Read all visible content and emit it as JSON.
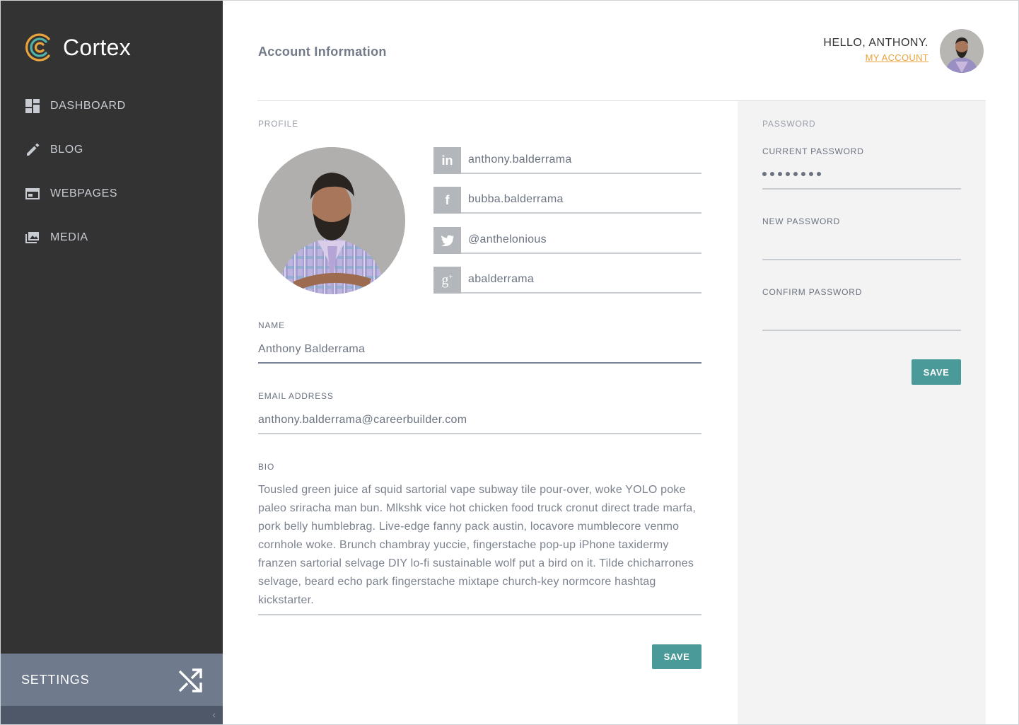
{
  "app": {
    "name": "Cortex"
  },
  "sidebar": {
    "items": [
      {
        "label": "DASHBOARD",
        "icon": "dashboard-icon"
      },
      {
        "label": "BLOG",
        "icon": "pencil-icon"
      },
      {
        "label": "WEBPAGES",
        "icon": "webpage-icon"
      },
      {
        "label": "MEDIA",
        "icon": "media-icon"
      }
    ],
    "settings": {
      "label": "SETTINGS",
      "icon": "shuffle-icon"
    },
    "collapse_icon": "chevron-left-icon"
  },
  "header": {
    "title": "Account Information",
    "greeting": "HELLO, ANTHONY.",
    "account_link": "MY ACCOUNT"
  },
  "profile": {
    "section_label": "PROFILE",
    "social": [
      {
        "network": "linkedin",
        "icon": "linkedin-icon",
        "value": "anthony.balderrama"
      },
      {
        "network": "facebook",
        "icon": "facebook-icon",
        "value": "bubba.balderrama"
      },
      {
        "network": "twitter",
        "icon": "twitter-icon",
        "value": "@anthelonious"
      },
      {
        "network": "google-plus",
        "icon": "google-plus-icon",
        "value": "abalderrama"
      }
    ],
    "name_label": "NAME",
    "name_value": "Anthony Balderrama",
    "email_label": "EMAIL ADDRESS",
    "email_value": "anthony.balderrama@careerbuilder.com",
    "bio_label": "BIO",
    "bio_value": "Tousled green juice af squid sartorial vape subway tile pour-over, woke YOLO poke paleo sriracha man bun. Mlkshk vice hot chicken food truck cronut direct trade marfa, pork belly humblebrag. Live-edge fanny pack austin, locavore mumblecore venmo cornhole woke. Brunch chambray yuccie, fingerstache pop-up iPhone taxidermy franzen sartorial selvage DIY lo-fi sustainable wolf put a bird on it. Tilde chicharrones selvage, beard echo park fingerstache mixtape church-key normcore hashtag kickstarter.",
    "save_label": "SAVE"
  },
  "password": {
    "section_label": "PASSWORD",
    "current_label": "CURRENT PASSWORD",
    "current_masked": "••••••••",
    "new_label": "NEW PASSWORD",
    "confirm_label": "CONFIRM PASSWORD",
    "save_label": "SAVE"
  },
  "colors": {
    "sidebar_bg": "#333333",
    "settings_bg": "#6f7a8c",
    "accent_teal": "#4a9a99",
    "link_orange": "#e8a33d",
    "panel_bg": "#f3f3f3"
  }
}
